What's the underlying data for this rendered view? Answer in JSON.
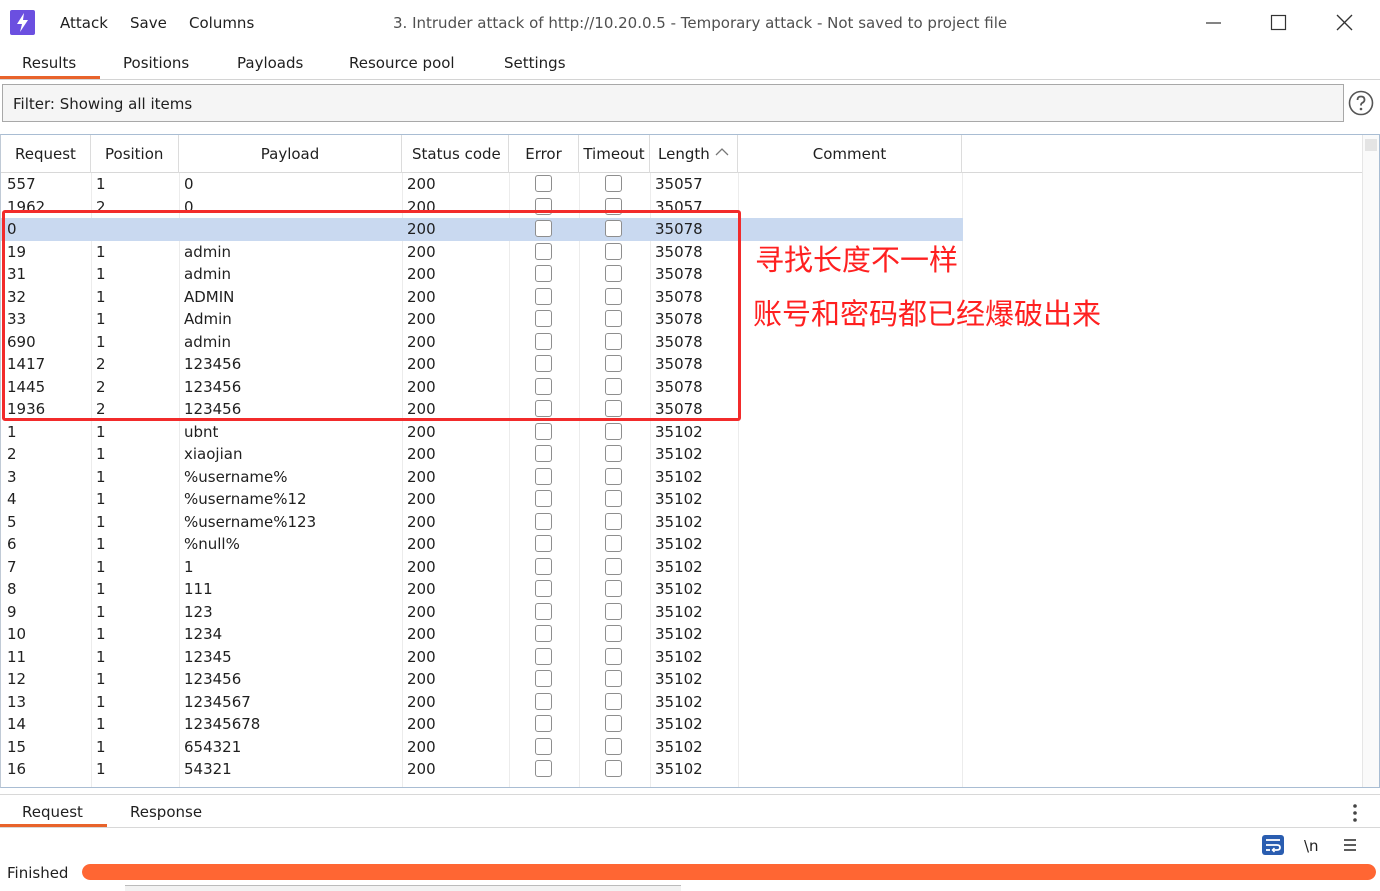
{
  "menu": {
    "attack": "Attack",
    "save": "Save",
    "columns": "Columns"
  },
  "window_title": "3. Intruder attack of http://10.20.0.5 - Temporary attack - Not saved to project file",
  "tabs": [
    "Results",
    "Positions",
    "Payloads",
    "Resource pool",
    "Settings"
  ],
  "active_tab": "Results",
  "filter": {
    "label": "Filter: Showing all items"
  },
  "table": {
    "columns": [
      "Request",
      "Position",
      "Payload",
      "Status code",
      "Error",
      "Timeout",
      "Length",
      "Comment"
    ],
    "sorted_column": "Length",
    "selected_row": 2,
    "rows": [
      [
        "557",
        "1",
        "0",
        "200",
        "35057"
      ],
      [
        "1962",
        "2",
        "0",
        "200",
        "35057"
      ],
      [
        "0",
        "",
        "",
        "200",
        "35078"
      ],
      [
        "19",
        "1",
        "admin",
        "200",
        "35078"
      ],
      [
        "31",
        "1",
        "admin",
        "200",
        "35078"
      ],
      [
        "32",
        "1",
        "ADMIN",
        "200",
        "35078"
      ],
      [
        "33",
        "1",
        "Admin",
        "200",
        "35078"
      ],
      [
        "690",
        "1",
        "admin",
        "200",
        "35078"
      ],
      [
        "1417",
        "2",
        "123456",
        "200",
        "35078"
      ],
      [
        "1445",
        "2",
        "123456",
        "200",
        "35078"
      ],
      [
        "1936",
        "2",
        "123456",
        "200",
        "35078"
      ],
      [
        "1",
        "1",
        "ubnt",
        "200",
        "35102"
      ],
      [
        "2",
        "1",
        "xiaojian",
        "200",
        "35102"
      ],
      [
        "3",
        "1",
        "%username%",
        "200",
        "35102"
      ],
      [
        "4",
        "1",
        "%username%12",
        "200",
        "35102"
      ],
      [
        "5",
        "1",
        "%username%123",
        "200",
        "35102"
      ],
      [
        "6",
        "1",
        "%null%",
        "200",
        "35102"
      ],
      [
        "7",
        "1",
        "1",
        "200",
        "35102"
      ],
      [
        "8",
        "1",
        "111",
        "200",
        "35102"
      ],
      [
        "9",
        "1",
        "123",
        "200",
        "35102"
      ],
      [
        "10",
        "1",
        "1234",
        "200",
        "35102"
      ],
      [
        "11",
        "1",
        "12345",
        "200",
        "35102"
      ],
      [
        "12",
        "1",
        "123456",
        "200",
        "35102"
      ],
      [
        "13",
        "1",
        "1234567",
        "200",
        "35102"
      ],
      [
        "14",
        "1",
        "12345678",
        "200",
        "35102"
      ],
      [
        "15",
        "1",
        "654321",
        "200",
        "35102"
      ],
      [
        "16",
        "1",
        "54321",
        "200",
        "35102"
      ]
    ]
  },
  "annotations": {
    "line1": "寻找长度不一样",
    "line2": "账号和密码都已经爆破出来",
    "color": "#ff2020"
  },
  "bottom_tabs": [
    "Request",
    "Response"
  ],
  "newline_label": "\\n",
  "status": {
    "text": "Finished",
    "progress": 1.0
  },
  "colors": {
    "accent": "#e8632b",
    "progress": "#ff6633",
    "selection": "#c9d9f0",
    "app_icon": "#6b4fe0",
    "annotation": "#f22b2b"
  }
}
